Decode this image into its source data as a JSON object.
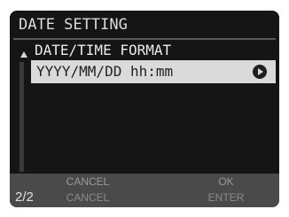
{
  "title": "DATE SETTING",
  "section_label": "DATE/TIME FORMAT",
  "selected_option": "YYYY/MM/DD hh:mm",
  "footer": {
    "page": "2/2",
    "cancel_label": "CANCEL",
    "ok_label": "OK",
    "cancel_label_secondary": "CANCEL",
    "enter_label": "ENTER"
  }
}
